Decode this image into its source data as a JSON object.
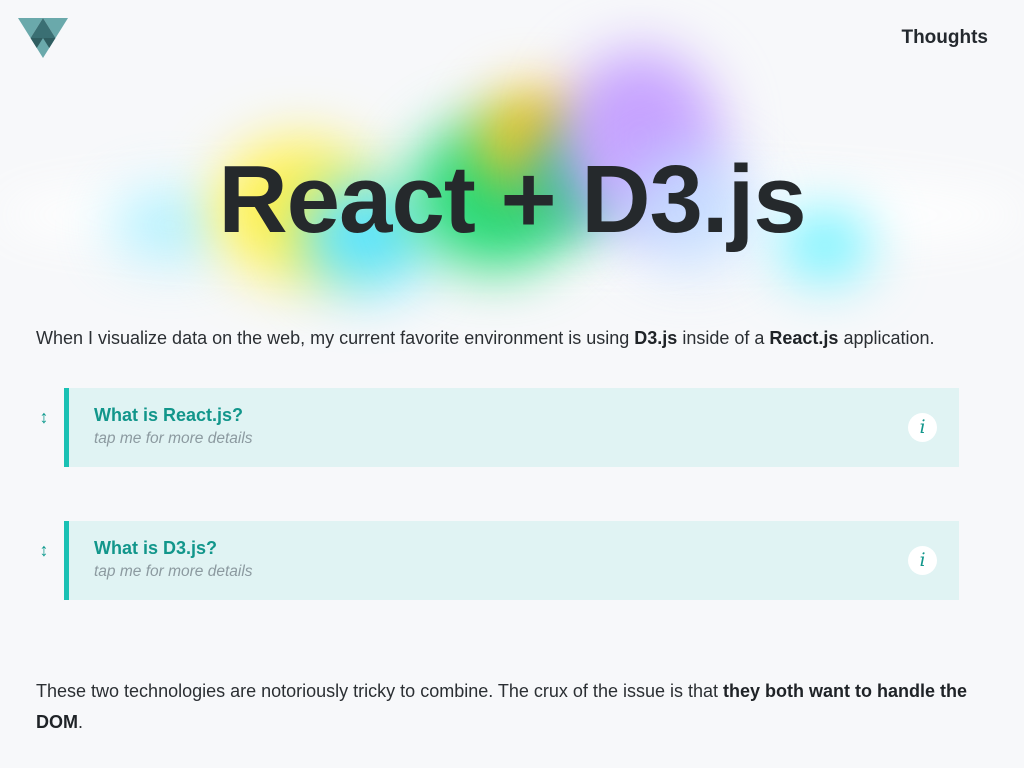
{
  "header": {
    "logo_icon": "triangle-logo-icon",
    "nav_link": "Thoughts"
  },
  "hero": {
    "title": "React + D3.js",
    "blob_colors": [
      "#ffef55",
      "#4be0ff",
      "#29e07a",
      "#ffb21c",
      "#c9a3ff",
      "#64f0ff"
    ]
  },
  "intro": {
    "part1": "When I visualize data on the web, my current favorite environment is using ",
    "strong1": "D3.js",
    "part2": " inside of a ",
    "strong2": "React.js",
    "part3": " application."
  },
  "cards": [
    {
      "title": "What is React.js?",
      "subtitle": "tap me for more details",
      "arrows": "↕",
      "info": "i"
    },
    {
      "title": "What is D3.js?",
      "subtitle": "tap me for more details",
      "arrows": "↕",
      "info": "i"
    }
  ],
  "outro": {
    "part1": "These two technologies are notoriously tricky to combine. The crux of the issue is that ",
    "strong": "they both want to handle the DOM",
    "part2": "."
  },
  "colors": {
    "accent": "#19c1b4",
    "accent_text": "#12968b",
    "card_bg": "#e0f3f3",
    "page_bg": "#f7f8fa"
  }
}
